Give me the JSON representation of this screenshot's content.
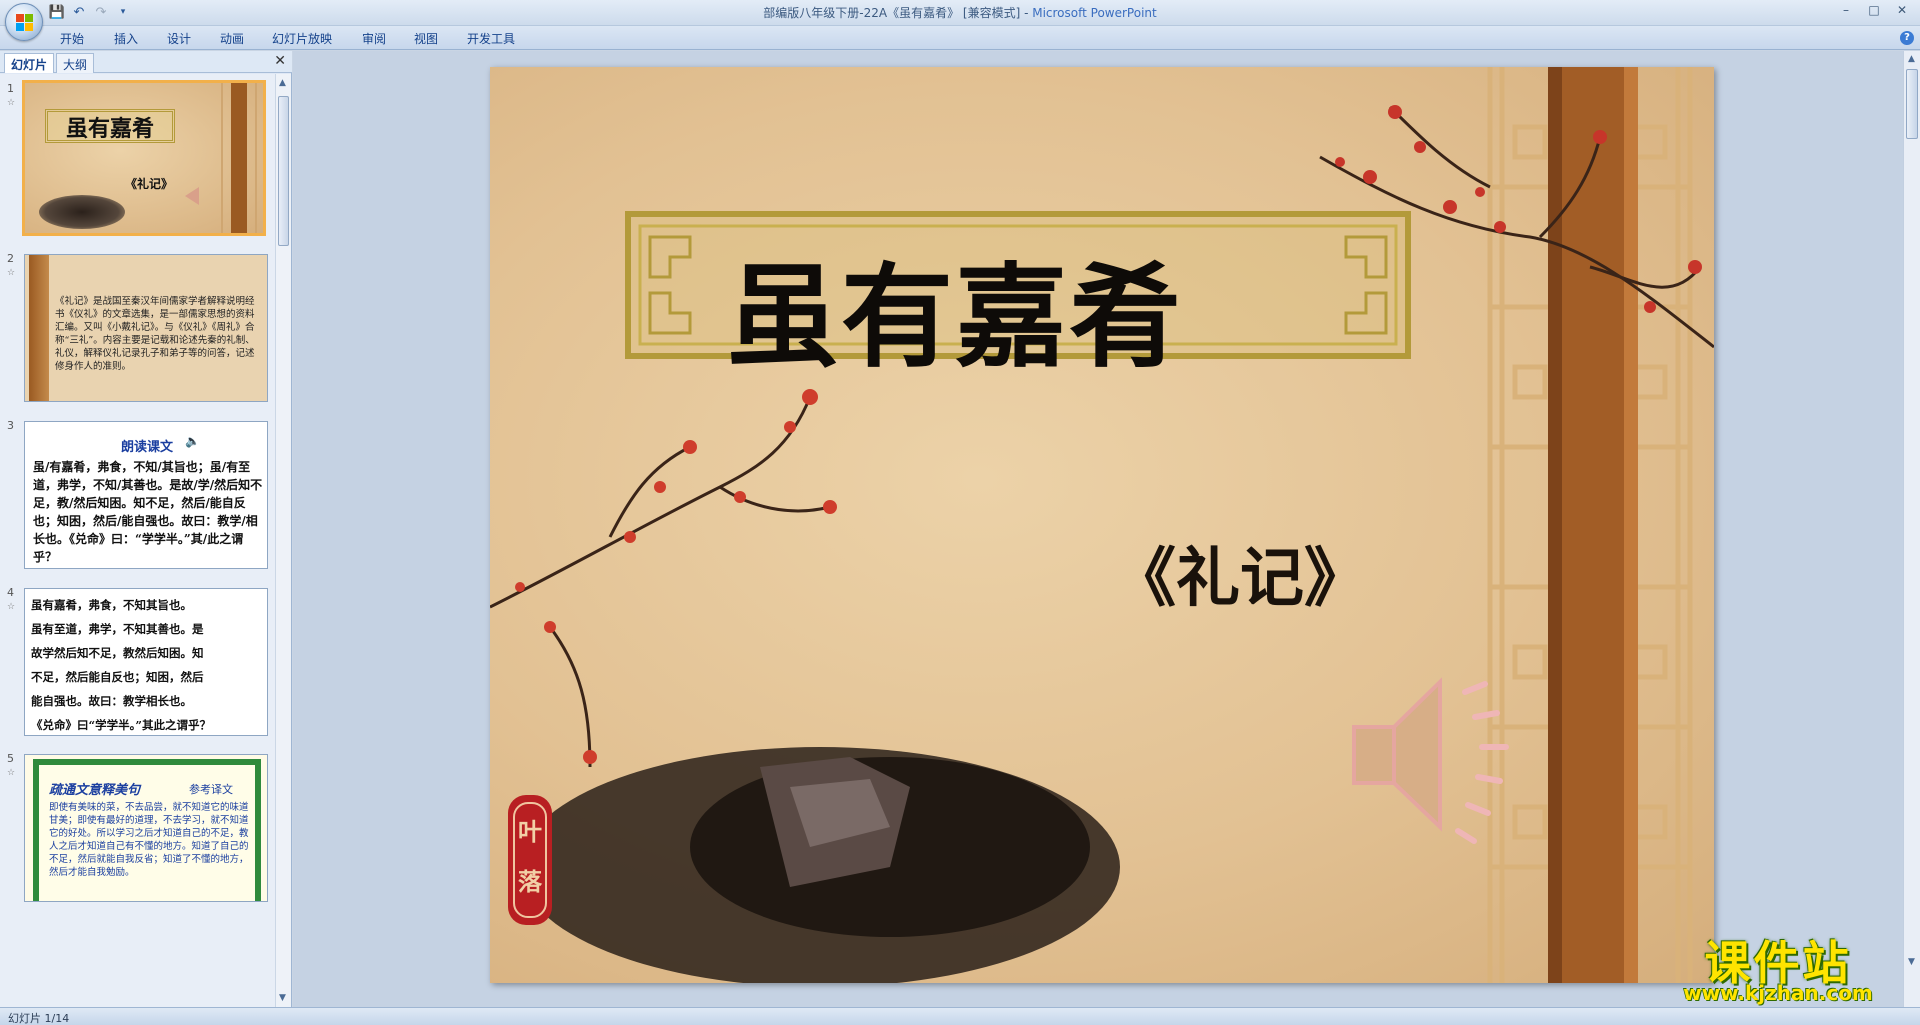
{
  "window": {
    "title": "部编版八年级下册-22A《虽有嘉肴》 [兼容模式] - ",
    "app_name": "Microsoft PowerPoint",
    "controls": [
      "–",
      "□",
      "✕"
    ]
  },
  "quick_access": {
    "icons": [
      "save-icon",
      "undo-icon",
      "redo-icon",
      "customize-icon"
    ]
  },
  "ribbon": {
    "tabs": [
      "开始",
      "插入",
      "设计",
      "动画",
      "幻灯片放映",
      "审阅",
      "视图",
      "开发工具"
    ]
  },
  "left_pane": {
    "tabs": [
      "幻灯片",
      "大纲"
    ],
    "close": "✕",
    "slides": [
      {
        "number": "1",
        "title": "虽有嘉肴",
        "subtitle": "《礼记》"
      },
      {
        "number": "2",
        "text": "《礼记》是战国至秦汉年间儒家学者解释说明经书《仪礼》的文章选集，是一部儒家思想的资料汇编。又叫《小戴礼记》。与《仪礼》《周礼》合称“三礼”。内容主要是记载和论述先秦的礼制、礼仪，解释仪礼记录孔子和弟子等的问答，记述修身作人的准则。"
      },
      {
        "number": "3",
        "heading": "朗读课文",
        "text": "虽/有嘉肴，弗食，不知/其旨也；虽/有至道，弗学，不知/其善也。是故/学/然后知不足，教/然后知困。知不足，然后/能自反也；知困，然后/能自强也。故曰：教学/相长也。《兑命》曰：“学学半。”其/此之谓乎？"
      },
      {
        "number": "4",
        "lines": [
          "虽有嘉肴，弗食，不知其旨也。",
          "虽有至道，弗学，不知其善也。是",
          "故学然后知不足，教然后知困。知",
          "不足，然后能自反也；知困，然后",
          "能自强也。故曰：教学相长也。",
          "《兑命》曰“学学半。”其此之谓乎？"
        ]
      },
      {
        "number": "5",
        "heading": "疏通文意释美句",
        "side": "参考译文",
        "text": "即使有美味的菜，不去品尝，就不知道它的味道甘美；即使有最好的道理，不去学习，就不知道它的好处。所以学习之后才知道自己的不足，教人之后才知道自己有不懂的地方。知道了自己的不足，然后就能自我反省；知道了不懂的地方，然后才能自我勉励。"
      }
    ]
  },
  "slide": {
    "title": "虽有嘉肴",
    "subtitle": "《礼记》",
    "seal": "叶落"
  },
  "status": {
    "text": "幻灯片 1/14"
  },
  "watermark": {
    "line1": "课件站",
    "line2": "www.kjzhan.com"
  }
}
